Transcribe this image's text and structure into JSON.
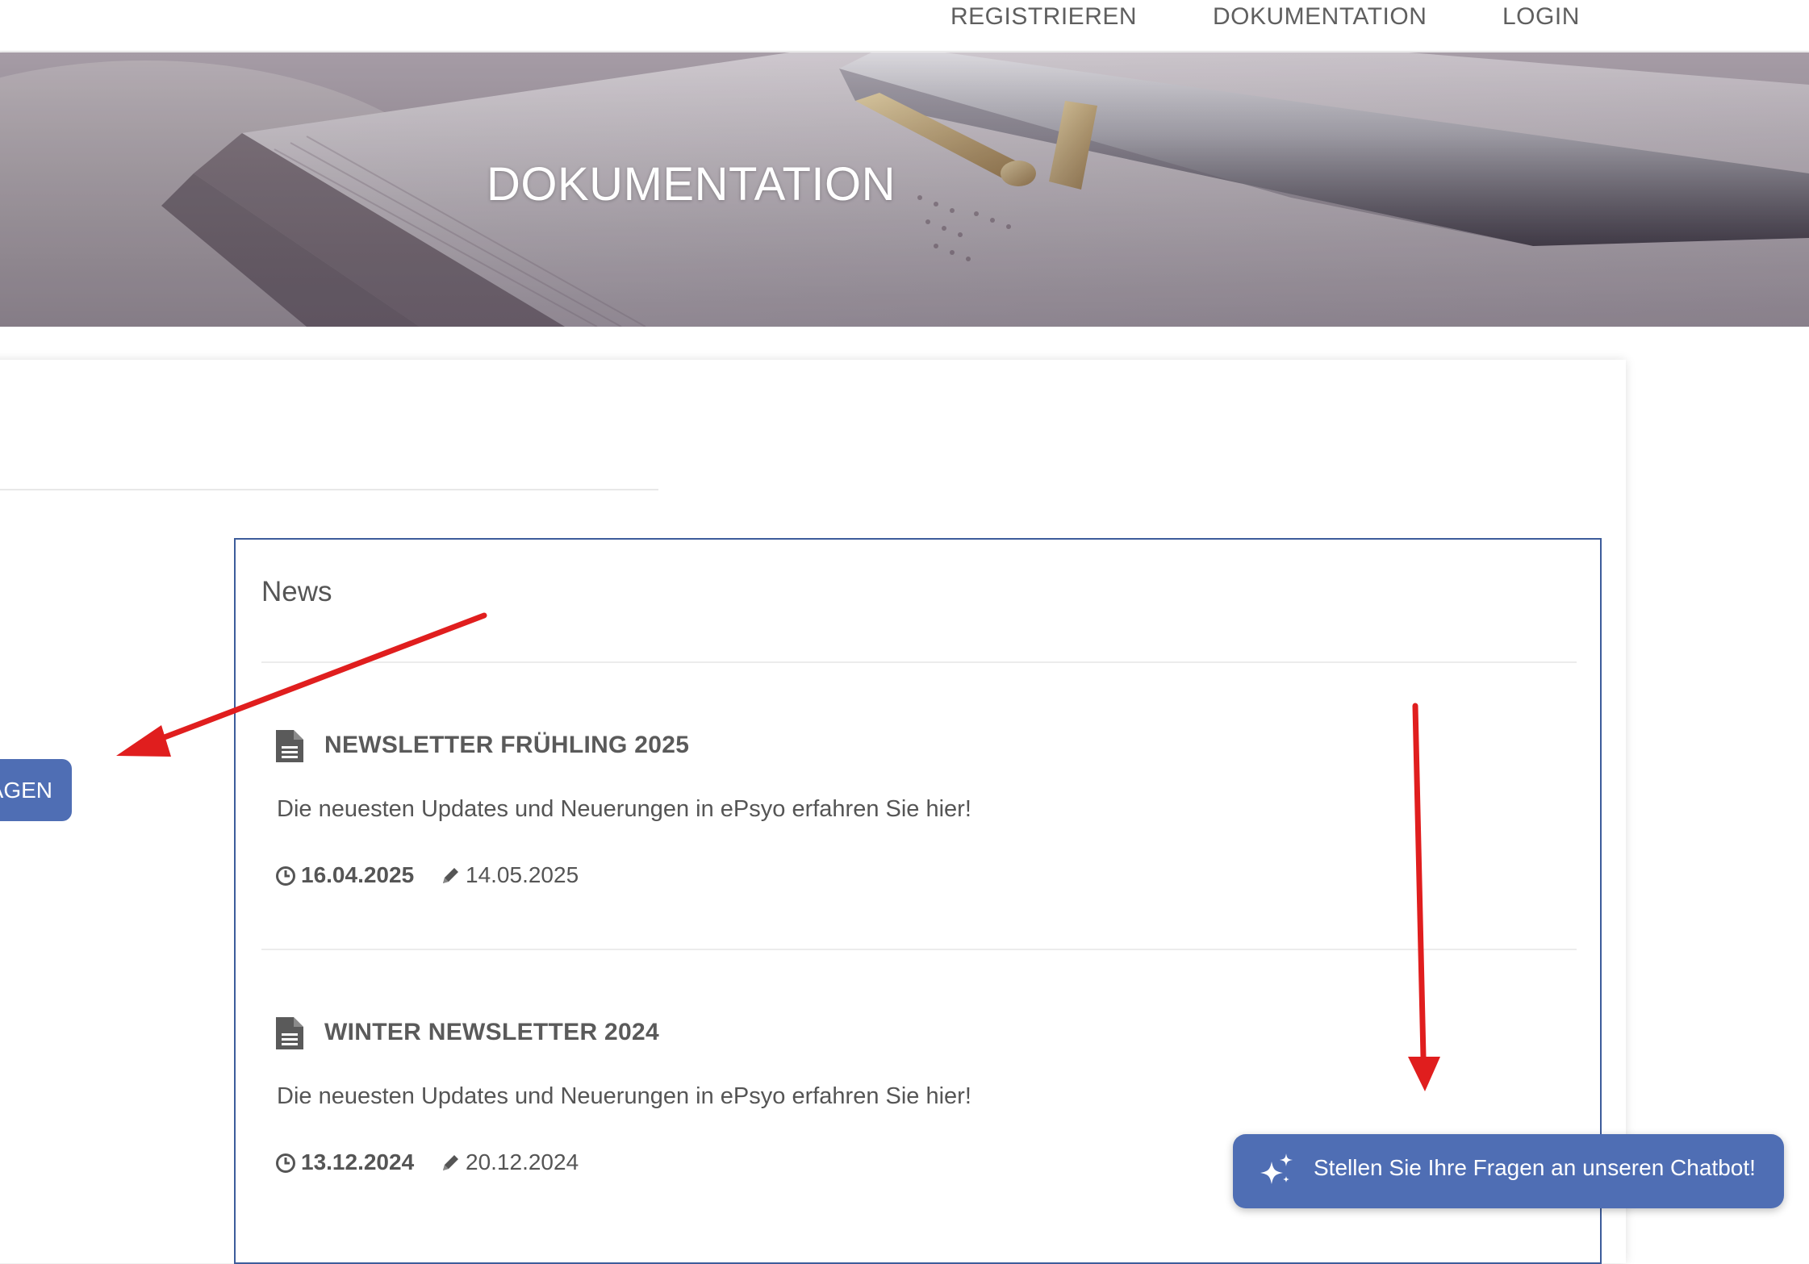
{
  "nav": {
    "register": "REGISTRIEREN",
    "documentation": "DOKUMENTATION",
    "login": "LOGIN"
  },
  "hero": {
    "title": "DOKUMENTATION"
  },
  "side_button": {
    "label": "AGEN"
  },
  "news": {
    "heading": "News",
    "items": [
      {
        "icon": "document-icon",
        "title": "NEWSLETTER FRÜHLING 2025",
        "description": "Die neuesten Updates und Neuerungen in ePsyo erfahren Sie hier!",
        "date": "16.04.2025",
        "edited": "14.05.2025"
      },
      {
        "icon": "document-icon",
        "title": "WINTER NEWSLETTER 2024",
        "description": "Die neuesten Updates und Neuerungen in ePsyo erfahren Sie hier!",
        "date": "13.12.2024",
        "edited": "20.12.2024"
      }
    ]
  },
  "chatbot": {
    "icon": "sparkle-icon",
    "label": "Stellen Sie Ihre Fragen an unseren Chatbot!"
  },
  "colors": {
    "primary": "#4f6eb4",
    "panel_border": "#3d5c9b",
    "annotation_arrow": "#e01e1e",
    "text": "#555555"
  }
}
